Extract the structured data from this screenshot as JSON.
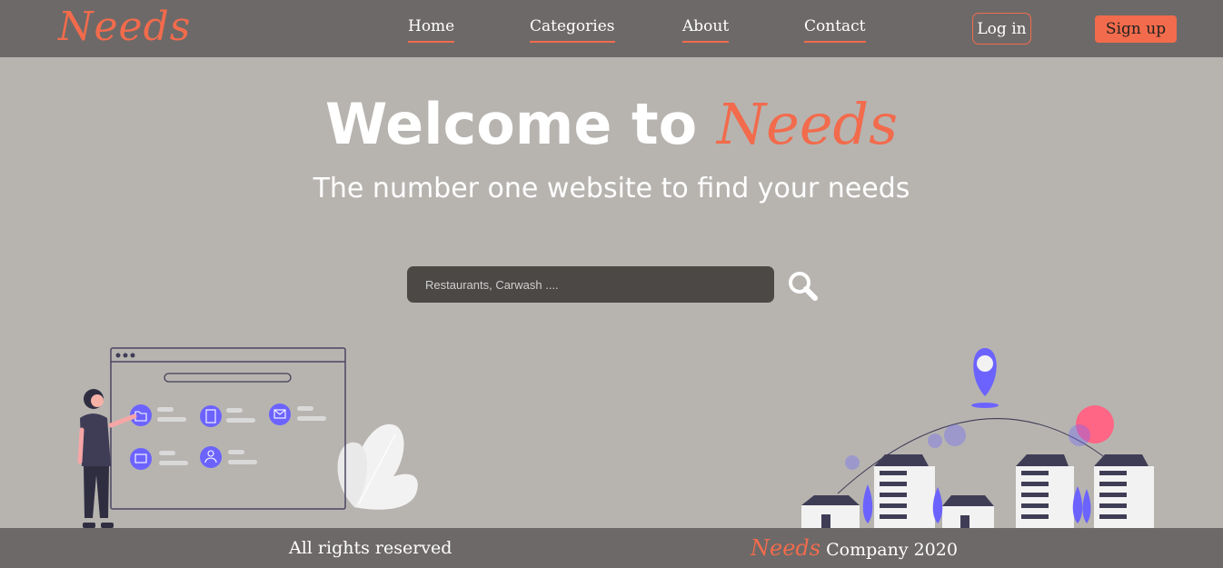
{
  "header": {
    "logo": "Needs",
    "nav": [
      "Home",
      "Categories",
      "About",
      "Contact"
    ],
    "login_label": "Log in",
    "signup_label": "Sign up"
  },
  "hero": {
    "title_prefix": "Welcome to ",
    "title_brand": "Needs",
    "subtitle": "The number one website to find your needs"
  },
  "search": {
    "placeholder": "Restaurants, Carwash ...."
  },
  "footer": {
    "left_text": "All rights reserved",
    "right_brand": "Needs",
    "right_text": "Company 2020"
  },
  "colors": {
    "accent": "#f26b4c",
    "bar": "#6d6968",
    "background": "#b7b4b0",
    "illustration": "#6c63ff"
  }
}
